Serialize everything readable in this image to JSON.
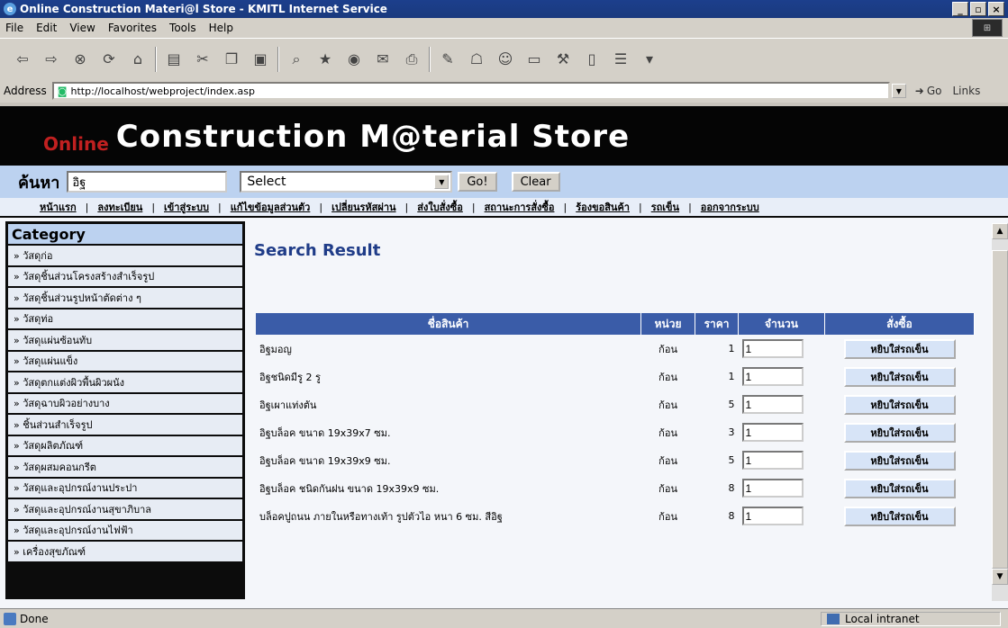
{
  "window": {
    "title": "Online Construction Materi@l Store - KMITL Internet Service"
  },
  "menu": [
    "File",
    "Edit",
    "View",
    "Favorites",
    "Tools",
    "Help"
  ],
  "address": {
    "label": "Address",
    "url": "http://localhost/webproject/index.asp",
    "go": "Go",
    "links": "Links"
  },
  "banner": {
    "prefix": "Online",
    "title": "Construction M@terial Store"
  },
  "search": {
    "label": "ค้นหา",
    "value": "อิฐ",
    "select_value": "Select",
    "go_label": "Go!",
    "clear_label": "Clear"
  },
  "nav": [
    "หน้าแรก",
    "ลงทะเบียน",
    "เข้าสู่ระบบ",
    "แก้ไขข้อมูลส่วนตัว",
    "เปลี่ยนรหัสผ่าน",
    "ส่งใบสั่งซื้อ",
    "สถานะการสั่งซื้อ",
    "ร้องขอสินค้า",
    "รถเข็น",
    "ออกจากระบบ"
  ],
  "sidebar": {
    "title": "Category",
    "items": [
      "» วัสดุก่อ",
      "» วัสดุชิ้นส่วนโครงสร้างสำเร็จรูป",
      "» วัสดุชิ้นส่วนรูปหน้าตัดต่าง ๆ",
      "» วัสดุท่อ",
      "» วัสดุแผ่นซ้อนทับ",
      "» วัสดุแผ่นแข็ง",
      "» วัสดุตกแต่งผิวพื้นผิวผนัง",
      "» วัสดุฉาบผิวอย่างบาง",
      "» ชิ้นส่วนสำเร็จรูป",
      "» วัสดุผลิตภัณฑ์",
      "» วัสดุผสมคอนกรีต",
      "» วัสดุและอุปกรณ์งานประปา",
      "» วัสดุและอุปกรณ์งานสุขาภิบาล",
      "» วัสดุและอุปกรณ์งานไฟฟ้า",
      "» เครื่องสุขภัณฑ์"
    ]
  },
  "results": {
    "title": "Search Result",
    "headers": [
      "ชื่อสินค้า",
      "หน่วย",
      "ราคา",
      "จำนวน",
      "สั่งซื้อ"
    ],
    "add_label": "หยิบใส่รถเข็น",
    "rows": [
      {
        "name": "อิฐมอญ",
        "unit": "ก้อน",
        "price": "1",
        "qty": "1"
      },
      {
        "name": "อิฐชนิดมีรู 2 รู",
        "unit": "ก้อน",
        "price": "1",
        "qty": "1"
      },
      {
        "name": "อิฐเผาแท่งตัน",
        "unit": "ก้อน",
        "price": "5",
        "qty": "1"
      },
      {
        "name": "อิฐบล็อค ขนาด 19x39x7 ซม.",
        "unit": "ก้อน",
        "price": "3",
        "qty": "1"
      },
      {
        "name": "อิฐบล็อค ขนาด 19x39x9 ซม.",
        "unit": "ก้อน",
        "price": "5",
        "qty": "1"
      },
      {
        "name": "อิฐบล็อค ชนิดกันฝน ขนาด 19x39x9 ซม.",
        "unit": "ก้อน",
        "price": "8",
        "qty": "1"
      },
      {
        "name": "บล็อคปูถนน ภายในหรือทางเท้า รูปตัวไอ หนา 6 ซม. สีอิฐ",
        "unit": "ก้อน",
        "price": "8",
        "qty": "1"
      }
    ]
  },
  "status": {
    "left": "Done",
    "right": "Local intranet"
  }
}
